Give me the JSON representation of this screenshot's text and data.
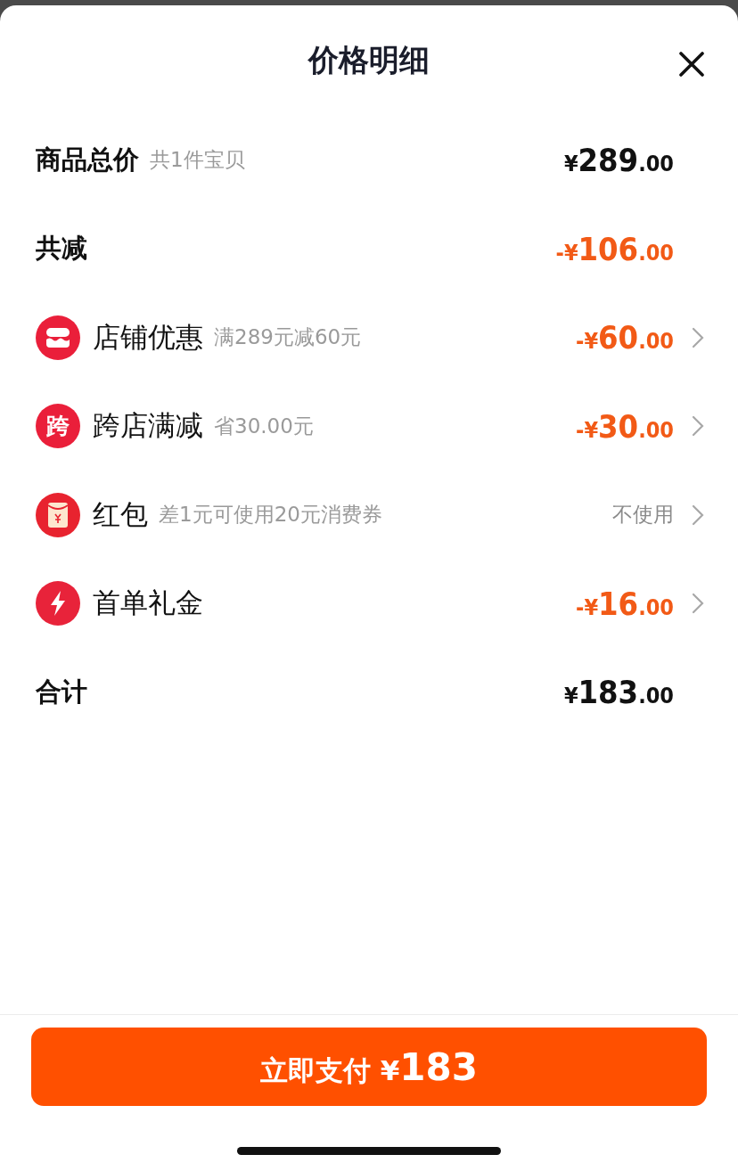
{
  "sheet": {
    "title": "价格明细"
  },
  "rows": [
    {
      "kind": "plain",
      "label": "商品总价",
      "note": "共1件宝贝",
      "discount": false,
      "amount": {
        "sign": "¥",
        "main": "289",
        "cents": ".00"
      },
      "chevron": false
    },
    {
      "kind": "plain",
      "label": "共减",
      "discount": true,
      "amount": {
        "sign": "-¥",
        "main": "106",
        "cents": ".00"
      },
      "chevron": false
    },
    {
      "kind": "store",
      "label": "店铺优惠",
      "note": "满289元减60元",
      "discount": true,
      "amount": {
        "sign": "-¥",
        "main": "60",
        "cents": ".00"
      },
      "chevron": true
    },
    {
      "kind": "cross",
      "badge": "跨",
      "label": "跨店满减",
      "note": "省30.00元",
      "discount": true,
      "amount": {
        "sign": "-¥",
        "main": "30",
        "cents": ".00"
      },
      "chevron": true
    },
    {
      "kind": "redpacket",
      "label": "红包",
      "note": "差1元可使用20元消费券",
      "status": "不使用",
      "chevron": true
    },
    {
      "kind": "gift",
      "label": "首单礼金",
      "discount": true,
      "amount": {
        "sign": "-¥",
        "main": "16",
        "cents": ".00"
      },
      "chevron": true
    },
    {
      "kind": "plain",
      "label": "合计",
      "discount": false,
      "amount": {
        "sign": "¥",
        "main": "183",
        "cents": ".00"
      },
      "chevron": false
    }
  ],
  "pay_button": {
    "label": "立即支付 ¥",
    "amount": "183"
  }
}
